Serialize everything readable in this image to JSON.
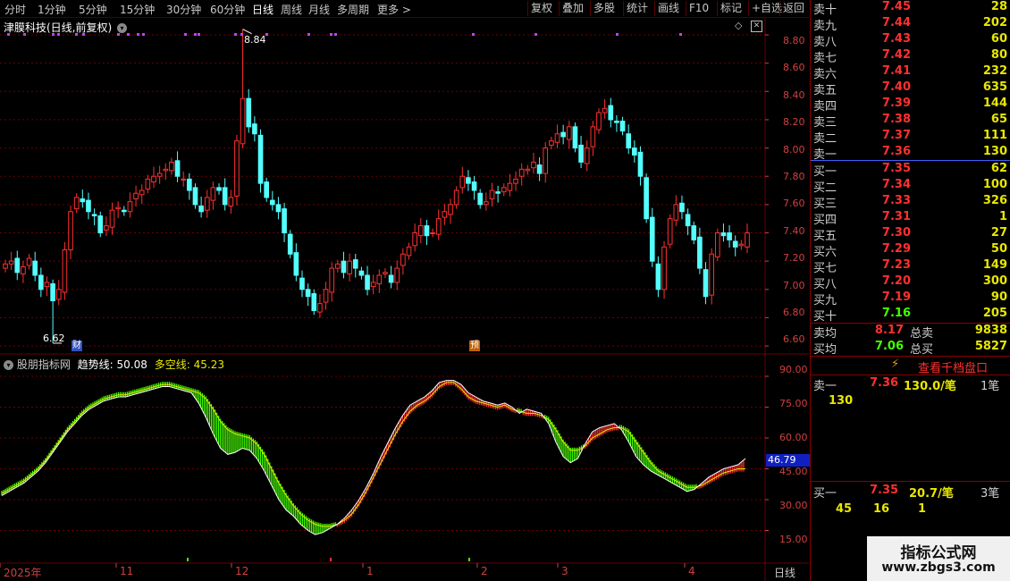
{
  "toolbar": {
    "timeframes": [
      "分时",
      "1分钟",
      "5分钟",
      "15分钟",
      "30分钟",
      "60分钟",
      "日线",
      "周线",
      "月线",
      "多周期",
      "更多 >"
    ],
    "active_timeframe": "日线",
    "tools": [
      "复权",
      "叠加",
      "多股",
      "统计",
      "画线",
      "F10",
      "标记",
      "+自选",
      "返回"
    ]
  },
  "main_chart": {
    "title": "津膜科技(日线,前复权)",
    "high_marker": "8.84",
    "low_marker": "6.62",
    "y_ticks": [
      "8.80",
      "8.60",
      "8.40",
      "8.20",
      "8.00",
      "7.80",
      "7.60",
      "7.40",
      "7.20",
      "7.00",
      "6.80",
      "6.60"
    ],
    "event_badges": [
      "财",
      "预"
    ]
  },
  "indicator": {
    "name": "股朋指标网",
    "line1_label": "趋势线:",
    "line1_value": "50.08",
    "line2_label": "多空线:",
    "line2_value": "45.23",
    "y_ticks": [
      "90.00",
      "75.00",
      "60.00",
      "45.00",
      "30.00",
      "15.00"
    ],
    "current_value_tag": "46.79"
  },
  "x_axis": {
    "labels": [
      "2025年",
      "11",
      "12",
      "1",
      "2",
      "3",
      "4"
    ],
    "period_label": "日线"
  },
  "order_book": {
    "asks": [
      {
        "label": "卖十",
        "price": "7.45",
        "vol": "28"
      },
      {
        "label": "卖九",
        "price": "7.44",
        "vol": "202"
      },
      {
        "label": "卖八",
        "price": "7.43",
        "vol": "60"
      },
      {
        "label": "卖七",
        "price": "7.42",
        "vol": "80"
      },
      {
        "label": "卖六",
        "price": "7.41",
        "vol": "232"
      },
      {
        "label": "卖五",
        "price": "7.40",
        "vol": "635"
      },
      {
        "label": "卖四",
        "price": "7.39",
        "vol": "144"
      },
      {
        "label": "卖三",
        "price": "7.38",
        "vol": "65"
      },
      {
        "label": "卖二",
        "price": "7.37",
        "vol": "111"
      },
      {
        "label": "卖一",
        "price": "7.36",
        "vol": "130"
      }
    ],
    "bids": [
      {
        "label": "买一",
        "price": "7.35",
        "vol": "62"
      },
      {
        "label": "买二",
        "price": "7.34",
        "vol": "100"
      },
      {
        "label": "买三",
        "price": "7.33",
        "vol": "326"
      },
      {
        "label": "买四",
        "price": "7.31",
        "vol": "1"
      },
      {
        "label": "买五",
        "price": "7.30",
        "vol": "27"
      },
      {
        "label": "买六",
        "price": "7.29",
        "vol": "50"
      },
      {
        "label": "买七",
        "price": "7.23",
        "vol": "149"
      },
      {
        "label": "买八",
        "price": "7.20",
        "vol": "300"
      },
      {
        "label": "买九",
        "price": "7.19",
        "vol": "90"
      },
      {
        "label": "买十",
        "price": "7.16",
        "vol": "205"
      }
    ],
    "avg_sell_label": "卖均",
    "avg_sell_price": "8.17",
    "total_sell_label": "总卖",
    "total_sell_vol": "9838",
    "avg_buy_label": "买均",
    "avg_buy_price": "7.06",
    "total_buy_label": "总买",
    "total_buy_vol": "5827",
    "view_button": "查看千档盘口",
    "ask1": {
      "label": "卖一",
      "price": "7.36",
      "detail": "130.0/笔",
      "count": "1笔",
      "queue": [
        "130"
      ]
    },
    "bid1": {
      "label": "买一",
      "price": "7.35",
      "detail": "20.7/笔",
      "count": "3笔",
      "queue": [
        "45",
        "16",
        "1"
      ]
    }
  },
  "watermark": {
    "line1": "指标公式网",
    "line2": "www.zbgs3.com"
  },
  "colors": {
    "up": "#ff3030",
    "down": "#54ffff",
    "grid": "#6a0000",
    "green": "#44ff00",
    "yellow": "#e8e800",
    "axis": "#d04040"
  },
  "chart_data": [
    {
      "type": "candlestick",
      "title": "津膜科技(日线,前复权)",
      "ylim": [
        6.55,
        8.92
      ],
      "high": 8.84,
      "low": 6.62,
      "close": [
        7.18,
        7.2,
        7.12,
        7.16,
        7.22,
        7.1,
        7.0,
        7.05,
        6.92,
        7.0,
        7.28,
        7.55,
        7.65,
        7.62,
        7.55,
        7.52,
        7.4,
        7.45,
        7.56,
        7.58,
        7.55,
        7.62,
        7.68,
        7.7,
        7.78,
        7.8,
        7.82,
        7.85,
        7.9,
        7.8,
        7.78,
        7.7,
        7.6,
        7.55,
        7.65,
        7.72,
        7.7,
        7.6,
        7.65,
        8.05,
        8.35,
        8.15,
        8.1,
        7.75,
        7.65,
        7.6,
        7.55,
        7.4,
        7.25,
        7.1,
        7.0,
        6.95,
        6.85,
        6.9,
        7.0,
        7.15,
        7.18,
        7.12,
        7.2,
        7.15,
        7.1,
        7.0,
        7.05,
        7.1,
        7.12,
        7.05,
        7.15,
        7.25,
        7.3,
        7.4,
        7.45,
        7.38,
        7.4,
        7.5,
        7.55,
        7.6,
        7.7,
        7.8,
        7.75,
        7.7,
        7.6,
        7.62,
        7.7,
        7.68,
        7.72,
        7.75,
        7.78,
        7.85,
        7.85,
        7.9,
        7.82,
        8.0,
        8.05,
        8.1,
        8.08,
        8.15,
        8.0,
        7.9,
        8.0,
        8.15,
        8.25,
        8.28,
        8.2,
        8.18,
        8.12,
        8.0,
        7.95,
        7.8,
        7.5,
        7.2,
        7.0,
        7.3,
        7.5,
        7.6,
        7.55,
        7.45,
        7.35,
        7.15,
        6.95,
        7.25,
        7.4,
        7.38,
        7.35,
        7.3,
        7.32,
        7.4
      ]
    },
    {
      "type": "area",
      "title": "股朋指标网",
      "series": [
        {
          "name": "趋势线",
          "values": [
            32,
            34,
            36,
            38,
            41,
            44,
            48,
            53,
            58,
            63,
            67,
            71,
            74,
            76,
            78,
            79,
            80,
            80,
            81,
            82,
            83,
            84,
            85,
            85,
            84,
            83,
            82,
            77,
            70,
            62,
            55,
            52,
            53,
            55,
            54,
            50,
            44,
            37,
            30,
            25,
            22,
            18,
            15,
            13,
            14,
            16,
            18,
            21,
            25,
            30,
            36,
            43,
            51,
            58,
            65,
            71,
            76,
            78,
            80,
            83,
            87,
            88,
            88,
            86,
            82,
            80,
            78,
            77,
            76,
            77,
            75,
            72,
            74,
            73,
            72,
            67,
            58,
            51,
            48,
            50,
            57,
            63,
            65,
            66,
            67,
            64,
            58,
            51,
            47,
            44,
            42,
            40,
            38,
            36,
            34,
            35,
            38,
            41,
            43,
            45,
            46,
            47,
            50
          ]
        },
        {
          "name": "多空线",
          "values": [
            33,
            35,
            37,
            39,
            42,
            45,
            49,
            54,
            59,
            64,
            68,
            72,
            75,
            77,
            79,
            80,
            81,
            81,
            82,
            83,
            84,
            85,
            86,
            86,
            85,
            84,
            83,
            82,
            79,
            74,
            68,
            64,
            62,
            61,
            60,
            57,
            52,
            45,
            38,
            32,
            27,
            23,
            20,
            18,
            17,
            17,
            18,
            20,
            23,
            28,
            34,
            41,
            48,
            55,
            62,
            68,
            73,
            76,
            78,
            81,
            85,
            87,
            87,
            84,
            80,
            78,
            77,
            76,
            75,
            76,
            74,
            73,
            72,
            72,
            71,
            69,
            64,
            58,
            54,
            54,
            56,
            60,
            62,
            64,
            65,
            65,
            63,
            58,
            53,
            48,
            44,
            42,
            40,
            38,
            36,
            36,
            37,
            39,
            41,
            43,
            44,
            45,
            45
          ]
        }
      ]
    }
  ]
}
